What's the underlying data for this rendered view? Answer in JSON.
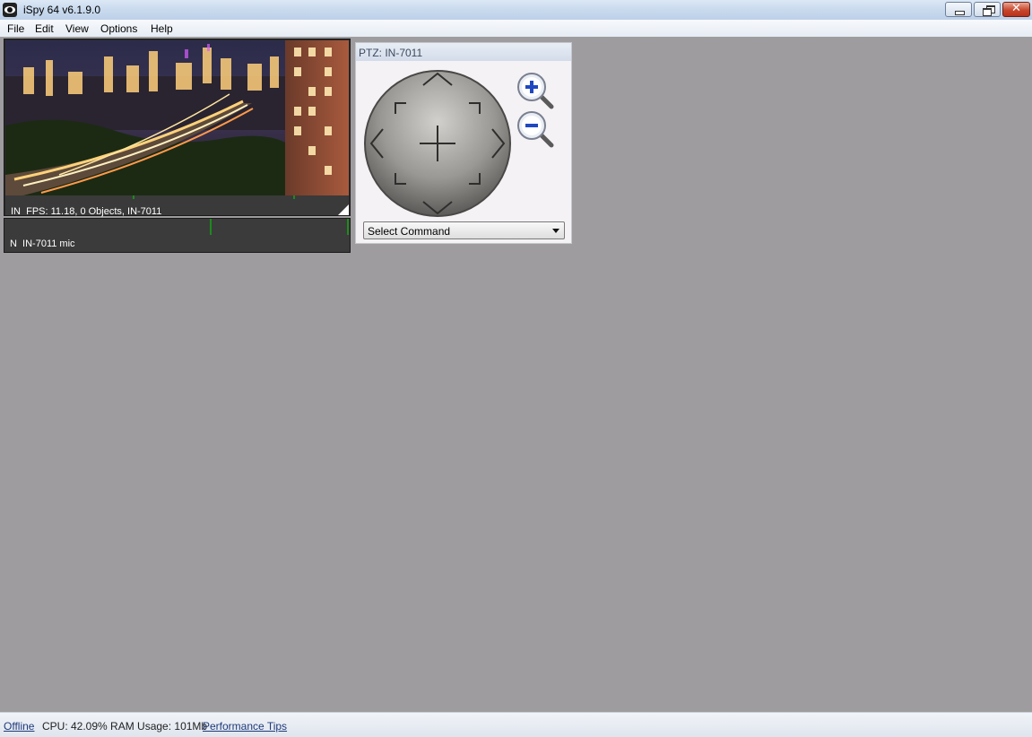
{
  "window": {
    "title": "iSpy 64 v6.1.9.0",
    "close_glyph": "✕"
  },
  "menu": {
    "items": [
      {
        "label": "File"
      },
      {
        "label": "Edit"
      },
      {
        "label": "View"
      },
      {
        "label": "Options"
      },
      {
        "label": "Help"
      }
    ]
  },
  "camera": {
    "info": "IN  FPS: 11.18, 0 Objects, IN-7011",
    "image_icon": "night-city-scene"
  },
  "microphone": {
    "info": "N  IN-7011 mic"
  },
  "ptz": {
    "title": "PTZ: IN-7011",
    "command_select": "Select Command",
    "zoom_in_icon": "zoom-in-icon",
    "zoom_out_icon": "zoom-out-icon"
  },
  "status": {
    "offline": "Offline",
    "usage": "CPU: 42.09% RAM Usage: 101Mb",
    "tips": "Performance Tips"
  },
  "colors": {
    "workspace": "#9e9c9e",
    "level_green": "#1d8a1d"
  }
}
